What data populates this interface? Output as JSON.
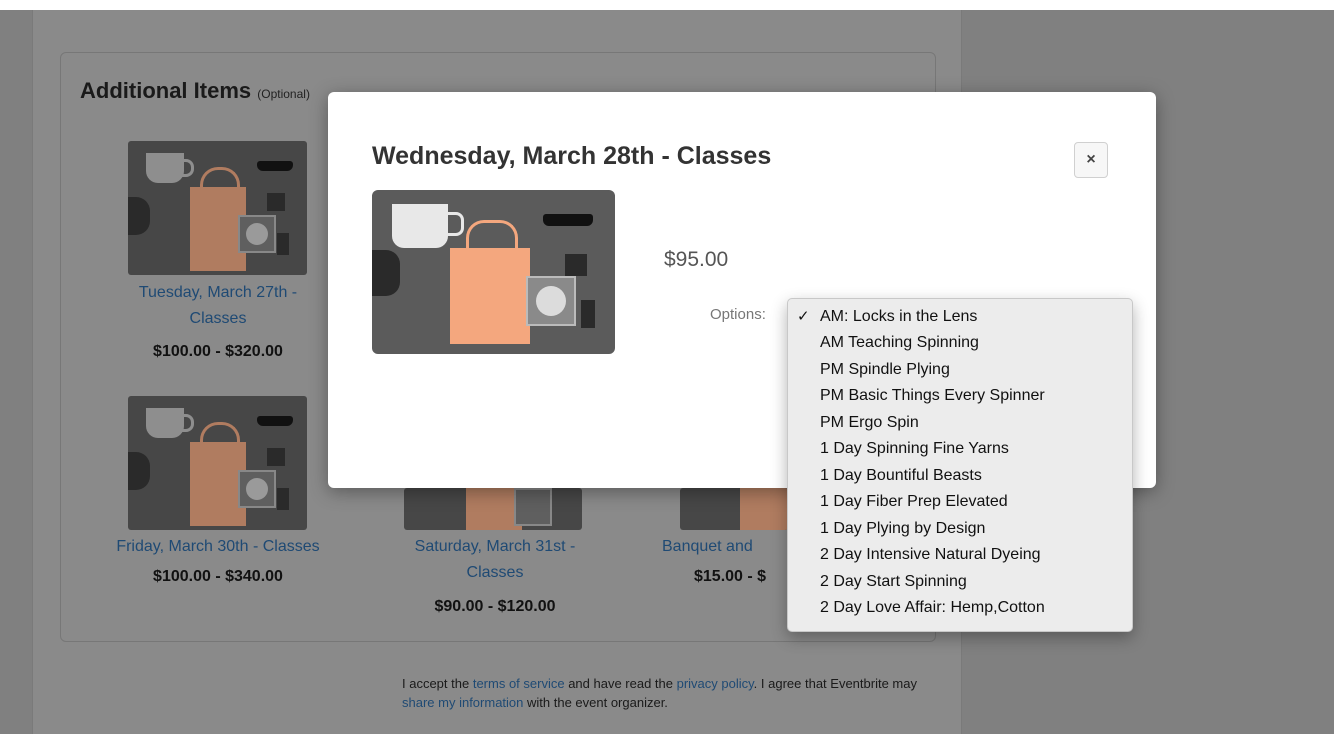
{
  "additional_items": {
    "heading": "Additional Items",
    "heading_note": "(Optional)",
    "items": [
      {
        "title_line1": "Tuesday, March 27th -",
        "title_line2": "Classes",
        "price": "$100.00 - $320.00"
      },
      {
        "title_line1": "Friday, March 30th - Classes",
        "price": "$100.00 - $340.00"
      },
      {
        "title_line1": "Saturday, March 31st -",
        "title_line2": "Classes",
        "price": "$90.00 - $120.00"
      },
      {
        "title_line1": "Banquet and",
        "price": "$15.00 - $"
      }
    ]
  },
  "terms": {
    "t1": "I accept the ",
    "terms_link": "terms of service",
    "t2": " and have read the ",
    "privacy_link": "privacy policy",
    "t3": ". I agree that Eventbrite may ",
    "share_link": "share my information",
    "t4": " with the event organizer."
  },
  "modal": {
    "title": "Wednesday, March 28th - Classes",
    "close_label": "×",
    "price": "$95.00",
    "options_label": "Options:"
  },
  "dropdown": {
    "checkmark": "✓",
    "selected_index": 0,
    "options": [
      "AM: Locks in the Lens",
      "AM Teaching Spinning",
      "PM Spindle Plying",
      "PM Basic Things Every Spinner",
      "PM Ergo Spin",
      "1 Day Spinning Fine Yarns",
      "1 Day Bountiful Beasts",
      "1 Day Fiber Prep Elevated",
      "1 Day Plying by Design",
      "2 Day Intensive Natural Dyeing",
      "2 Day Start Spinning",
      "2 Day Love Affair: Hemp,Cotton"
    ]
  },
  "colors": {
    "overlay": "#808080",
    "link": "#1f4a74",
    "bag": "#f4a77e"
  }
}
